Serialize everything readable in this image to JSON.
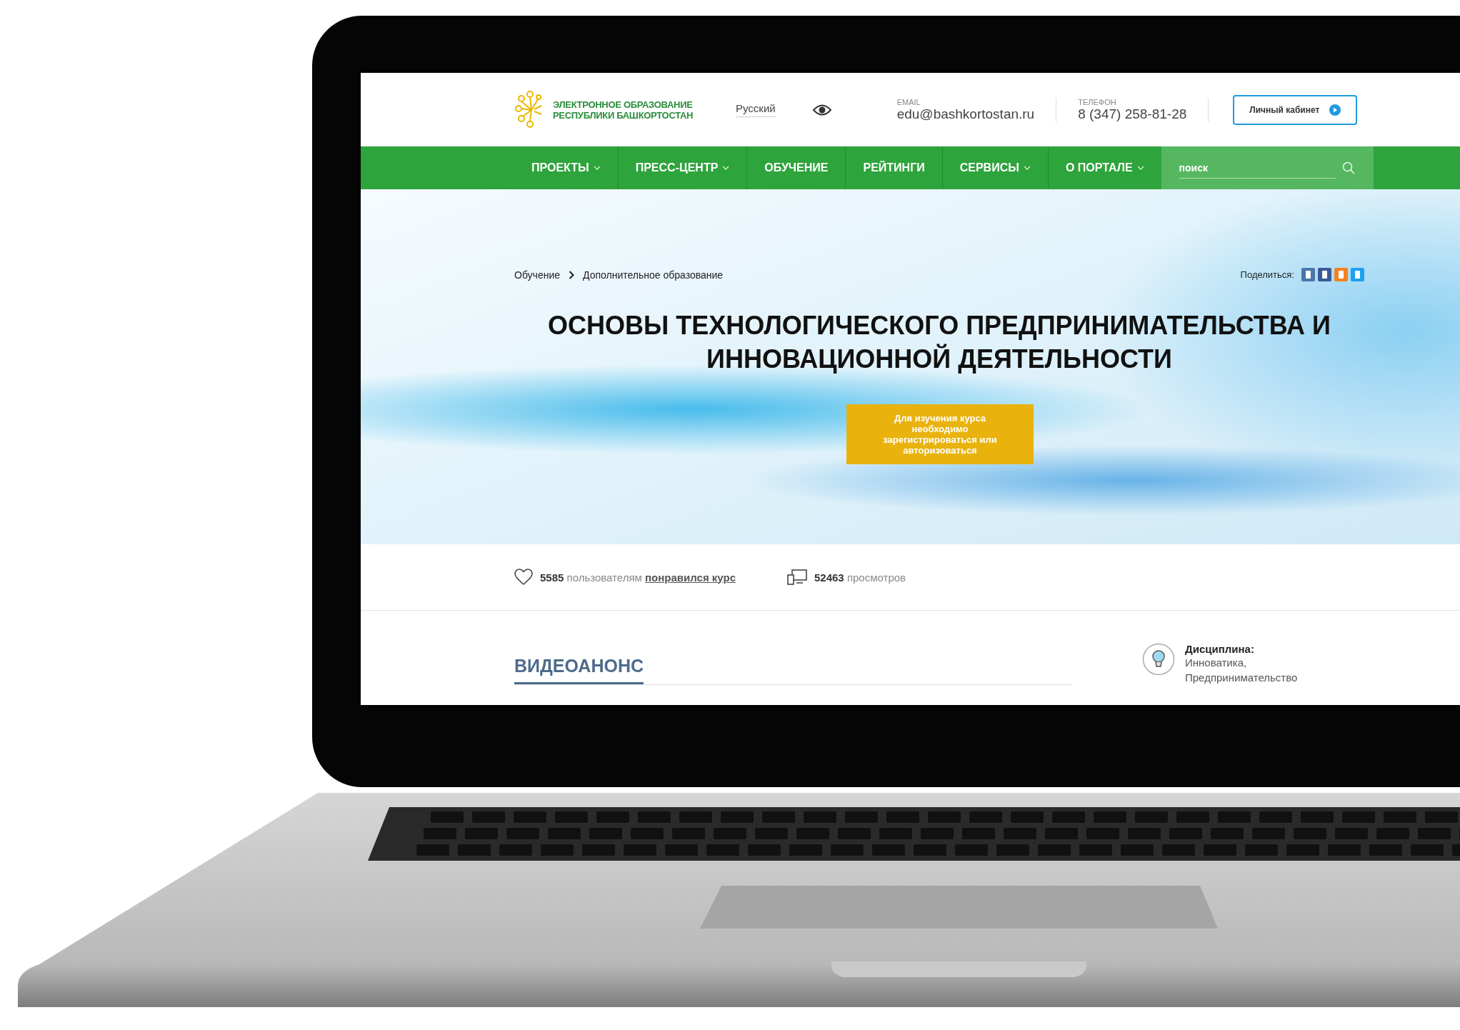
{
  "header": {
    "logo": {
      "line1": "ЭЛЕКТРОННОЕ ОБРАЗОВАНИЕ",
      "line2": "РЕСПУБЛИКИ БАШКОРТОСТАН"
    },
    "language": "Русский",
    "email": {
      "label": "EMAIL",
      "value": "edu@bashkortostan.ru"
    },
    "phone": {
      "label": "ТЕЛЕФОН",
      "value": "8 (347) 258-81-28"
    },
    "account_button": "Личный кабинет"
  },
  "nav": {
    "items": [
      {
        "label": "ПРОЕКТЫ",
        "dropdown": true
      },
      {
        "label": "ПРЕСС-ЦЕНТР",
        "dropdown": true
      },
      {
        "label": "ОБУЧЕНИЕ",
        "dropdown": false
      },
      {
        "label": "РЕЙТИНГИ",
        "dropdown": false
      },
      {
        "label": "СЕРВИСЫ",
        "dropdown": true
      },
      {
        "label": "О ПОРТАЛЕ",
        "dropdown": true
      }
    ],
    "search": {
      "placeholder": "поиск"
    }
  },
  "hero": {
    "breadcrumbs": [
      "Обучение",
      "Дополнительное образование"
    ],
    "share": {
      "label": "Поделиться:",
      "buttons": [
        {
          "color": "#4a76a8"
        },
        {
          "color": "#3b5998"
        },
        {
          "color": "#f58220"
        },
        {
          "color": "#1da1f2"
        }
      ]
    },
    "title": "ОСНОВЫ ТЕХНОЛОГИЧЕСКОГО ПРЕДПРИНИМАТЕЛЬСТВА И ИННОВАЦИОННОЙ ДЕЯТЕЛЬНОСТИ",
    "notice_button": "Для изучения курса необходимо зарегистрироваться или авторизоваться"
  },
  "stats": {
    "likes": {
      "count": "5585",
      "text": "пользователям",
      "link": "понравился курс"
    },
    "views": {
      "count": "52463",
      "text": "просмотров"
    }
  },
  "section": {
    "title": "ВИДЕОАНОНС",
    "discipline": {
      "label": "Дисциплина:",
      "value": "Инноватика, Предпринимательство"
    }
  }
}
